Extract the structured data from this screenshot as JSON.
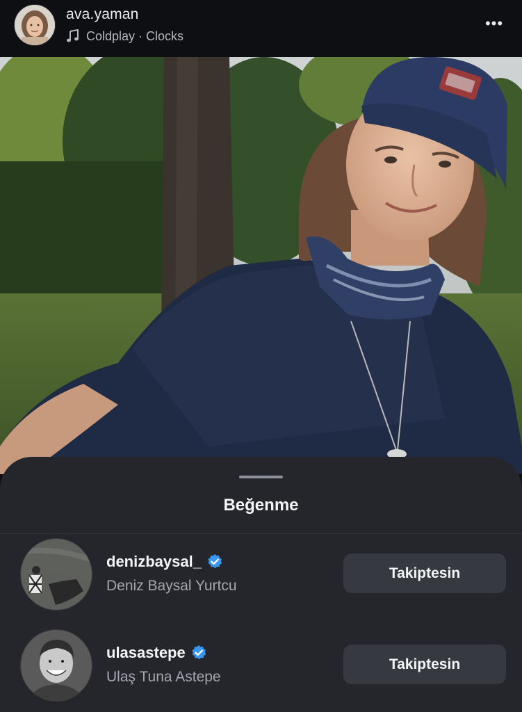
{
  "header": {
    "username": "ava.yaman",
    "music_icon": "music-note-icon",
    "song": "Coldplay · Clocks",
    "more_icon": "more-options-icon",
    "more_label": "•••"
  },
  "sheet": {
    "title": "Beğenme",
    "likes": [
      {
        "username": "denizbaysal_",
        "verified": true,
        "full_name": "Deniz Baysal Yurtcu",
        "button_label": "Takiptesin"
      },
      {
        "username": "ulasastepe",
        "verified": true,
        "full_name": "Ulaş Tuna Astepe",
        "button_label": "Takiptesin"
      }
    ]
  },
  "colors": {
    "background": "#0e0f12",
    "sheet": "#25262b",
    "button": "#363940",
    "verified_blue": "#3897f0",
    "secondary_text": "#a4a7ae"
  }
}
